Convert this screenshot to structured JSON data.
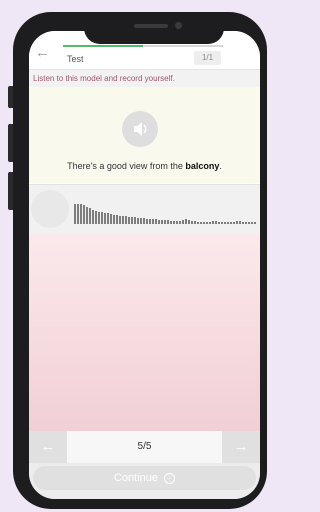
{
  "header": {
    "title": "Test",
    "counter": "1/1",
    "progress": 0.5
  },
  "instruction": "Listen to this model and record yourself.",
  "model": {
    "sentence_prefix": "There's a good view from the ",
    "sentence_keyword": "balcony",
    "sentence_suffix": "."
  },
  "navigation": {
    "page": "5/5",
    "prev_icon": "←",
    "next_icon": "→"
  },
  "continue_label": "Continue",
  "icons": {
    "back": "←",
    "continue": "›"
  },
  "colors": {
    "instruction_text": "#a05a6c",
    "progress": "#55b86d",
    "practice_top": "#fbe9ec",
    "practice_bottom": "#f1cfd6"
  }
}
